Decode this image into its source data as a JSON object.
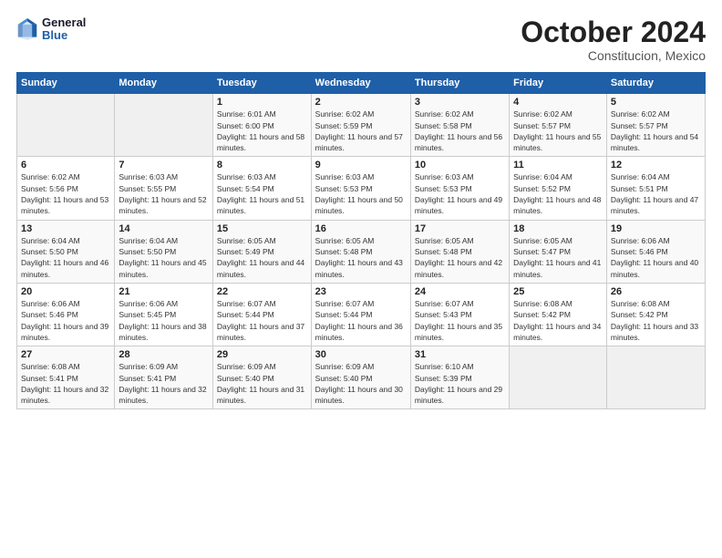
{
  "logo": {
    "line1": "General",
    "line2": "Blue"
  },
  "title": "October 2024",
  "subtitle": "Constitucion, Mexico",
  "weekdays": [
    "Sunday",
    "Monday",
    "Tuesday",
    "Wednesday",
    "Thursday",
    "Friday",
    "Saturday"
  ],
  "weeks": [
    [
      {
        "day": "",
        "sunrise": "",
        "sunset": "",
        "daylight": "",
        "empty": true
      },
      {
        "day": "",
        "sunrise": "",
        "sunset": "",
        "daylight": "",
        "empty": true
      },
      {
        "day": "1",
        "sunrise": "Sunrise: 6:01 AM",
        "sunset": "Sunset: 6:00 PM",
        "daylight": "Daylight: 11 hours and 58 minutes."
      },
      {
        "day": "2",
        "sunrise": "Sunrise: 6:02 AM",
        "sunset": "Sunset: 5:59 PM",
        "daylight": "Daylight: 11 hours and 57 minutes."
      },
      {
        "day": "3",
        "sunrise": "Sunrise: 6:02 AM",
        "sunset": "Sunset: 5:58 PM",
        "daylight": "Daylight: 11 hours and 56 minutes."
      },
      {
        "day": "4",
        "sunrise": "Sunrise: 6:02 AM",
        "sunset": "Sunset: 5:57 PM",
        "daylight": "Daylight: 11 hours and 55 minutes."
      },
      {
        "day": "5",
        "sunrise": "Sunrise: 6:02 AM",
        "sunset": "Sunset: 5:57 PM",
        "daylight": "Daylight: 11 hours and 54 minutes."
      }
    ],
    [
      {
        "day": "6",
        "sunrise": "Sunrise: 6:02 AM",
        "sunset": "Sunset: 5:56 PM",
        "daylight": "Daylight: 11 hours and 53 minutes."
      },
      {
        "day": "7",
        "sunrise": "Sunrise: 6:03 AM",
        "sunset": "Sunset: 5:55 PM",
        "daylight": "Daylight: 11 hours and 52 minutes."
      },
      {
        "day": "8",
        "sunrise": "Sunrise: 6:03 AM",
        "sunset": "Sunset: 5:54 PM",
        "daylight": "Daylight: 11 hours and 51 minutes."
      },
      {
        "day": "9",
        "sunrise": "Sunrise: 6:03 AM",
        "sunset": "Sunset: 5:53 PM",
        "daylight": "Daylight: 11 hours and 50 minutes."
      },
      {
        "day": "10",
        "sunrise": "Sunrise: 6:03 AM",
        "sunset": "Sunset: 5:53 PM",
        "daylight": "Daylight: 11 hours and 49 minutes."
      },
      {
        "day": "11",
        "sunrise": "Sunrise: 6:04 AM",
        "sunset": "Sunset: 5:52 PM",
        "daylight": "Daylight: 11 hours and 48 minutes."
      },
      {
        "day": "12",
        "sunrise": "Sunrise: 6:04 AM",
        "sunset": "Sunset: 5:51 PM",
        "daylight": "Daylight: 11 hours and 47 minutes."
      }
    ],
    [
      {
        "day": "13",
        "sunrise": "Sunrise: 6:04 AM",
        "sunset": "Sunset: 5:50 PM",
        "daylight": "Daylight: 11 hours and 46 minutes."
      },
      {
        "day": "14",
        "sunrise": "Sunrise: 6:04 AM",
        "sunset": "Sunset: 5:50 PM",
        "daylight": "Daylight: 11 hours and 45 minutes."
      },
      {
        "day": "15",
        "sunrise": "Sunrise: 6:05 AM",
        "sunset": "Sunset: 5:49 PM",
        "daylight": "Daylight: 11 hours and 44 minutes."
      },
      {
        "day": "16",
        "sunrise": "Sunrise: 6:05 AM",
        "sunset": "Sunset: 5:48 PM",
        "daylight": "Daylight: 11 hours and 43 minutes."
      },
      {
        "day": "17",
        "sunrise": "Sunrise: 6:05 AM",
        "sunset": "Sunset: 5:48 PM",
        "daylight": "Daylight: 11 hours and 42 minutes."
      },
      {
        "day": "18",
        "sunrise": "Sunrise: 6:05 AM",
        "sunset": "Sunset: 5:47 PM",
        "daylight": "Daylight: 11 hours and 41 minutes."
      },
      {
        "day": "19",
        "sunrise": "Sunrise: 6:06 AM",
        "sunset": "Sunset: 5:46 PM",
        "daylight": "Daylight: 11 hours and 40 minutes."
      }
    ],
    [
      {
        "day": "20",
        "sunrise": "Sunrise: 6:06 AM",
        "sunset": "Sunset: 5:46 PM",
        "daylight": "Daylight: 11 hours and 39 minutes."
      },
      {
        "day": "21",
        "sunrise": "Sunrise: 6:06 AM",
        "sunset": "Sunset: 5:45 PM",
        "daylight": "Daylight: 11 hours and 38 minutes."
      },
      {
        "day": "22",
        "sunrise": "Sunrise: 6:07 AM",
        "sunset": "Sunset: 5:44 PM",
        "daylight": "Daylight: 11 hours and 37 minutes."
      },
      {
        "day": "23",
        "sunrise": "Sunrise: 6:07 AM",
        "sunset": "Sunset: 5:44 PM",
        "daylight": "Daylight: 11 hours and 36 minutes."
      },
      {
        "day": "24",
        "sunrise": "Sunrise: 6:07 AM",
        "sunset": "Sunset: 5:43 PM",
        "daylight": "Daylight: 11 hours and 35 minutes."
      },
      {
        "day": "25",
        "sunrise": "Sunrise: 6:08 AM",
        "sunset": "Sunset: 5:42 PM",
        "daylight": "Daylight: 11 hours and 34 minutes."
      },
      {
        "day": "26",
        "sunrise": "Sunrise: 6:08 AM",
        "sunset": "Sunset: 5:42 PM",
        "daylight": "Daylight: 11 hours and 33 minutes."
      }
    ],
    [
      {
        "day": "27",
        "sunrise": "Sunrise: 6:08 AM",
        "sunset": "Sunset: 5:41 PM",
        "daylight": "Daylight: 11 hours and 32 minutes."
      },
      {
        "day": "28",
        "sunrise": "Sunrise: 6:09 AM",
        "sunset": "Sunset: 5:41 PM",
        "daylight": "Daylight: 11 hours and 32 minutes."
      },
      {
        "day": "29",
        "sunrise": "Sunrise: 6:09 AM",
        "sunset": "Sunset: 5:40 PM",
        "daylight": "Daylight: 11 hours and 31 minutes."
      },
      {
        "day": "30",
        "sunrise": "Sunrise: 6:09 AM",
        "sunset": "Sunset: 5:40 PM",
        "daylight": "Daylight: 11 hours and 30 minutes."
      },
      {
        "day": "31",
        "sunrise": "Sunrise: 6:10 AM",
        "sunset": "Sunset: 5:39 PM",
        "daylight": "Daylight: 11 hours and 29 minutes."
      },
      {
        "day": "",
        "sunrise": "",
        "sunset": "",
        "daylight": "",
        "empty": true
      },
      {
        "day": "",
        "sunrise": "",
        "sunset": "",
        "daylight": "",
        "empty": true
      }
    ]
  ]
}
